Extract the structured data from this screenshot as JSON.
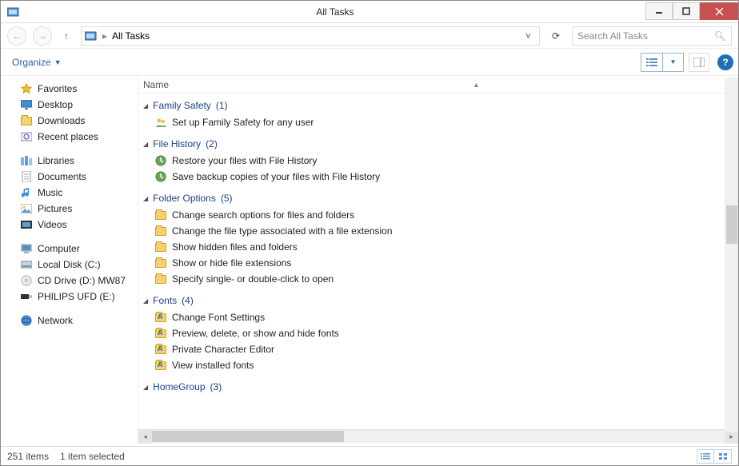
{
  "window": {
    "title": "All Tasks"
  },
  "nav": {
    "breadcrumb_label": "All Tasks",
    "search_placeholder": "Search All Tasks"
  },
  "toolbar": {
    "organize": "Organize"
  },
  "column_header": "Name",
  "sidebar": {
    "favorites": {
      "label": "Favorites",
      "items": [
        "Desktop",
        "Downloads",
        "Recent places"
      ]
    },
    "libraries": {
      "label": "Libraries",
      "items": [
        "Documents",
        "Music",
        "Pictures",
        "Videos"
      ]
    },
    "computer": {
      "label": "Computer",
      "items": [
        "Local Disk (C:)",
        "CD Drive (D:) MW87",
        "PHILIPS UFD (E:)"
      ]
    },
    "network": {
      "label": "Network"
    }
  },
  "groups": [
    {
      "name": "Family Safety",
      "count": 1,
      "items": [
        "Set up Family Safety for any user"
      ],
      "icon": "people"
    },
    {
      "name": "File History",
      "count": 2,
      "items": [
        "Restore your files with File History",
        "Save backup copies of your files with File History"
      ],
      "icon": "history"
    },
    {
      "name": "Folder Options",
      "count": 5,
      "items": [
        "Change search options for files and folders",
        "Change the file type associated with a file extension",
        "Show hidden files and folders",
        "Show or hide file extensions",
        "Specify single- or double-click to open"
      ],
      "icon": "folder"
    },
    {
      "name": "Fonts",
      "count": 4,
      "items": [
        "Change Font Settings",
        "Preview, delete, or show and hide fonts",
        "Private Character Editor",
        "View installed fonts"
      ],
      "icon": "font"
    },
    {
      "name": "HomeGroup",
      "count": 3,
      "items": [],
      "icon": "home"
    }
  ],
  "status": {
    "total": "251 items",
    "selected": "1 item selected"
  }
}
